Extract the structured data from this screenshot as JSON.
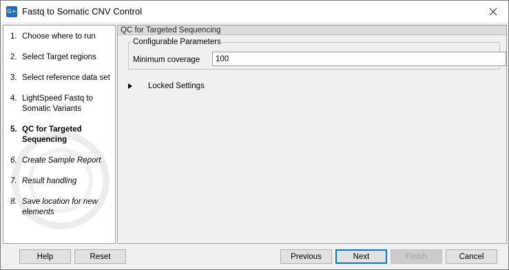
{
  "window": {
    "title": "Fastq to Somatic CNV Control",
    "app_icon_text": "G+"
  },
  "sidebar": {
    "steps": [
      {
        "num": "1.",
        "label": "Choose where to run",
        "state": "done"
      },
      {
        "num": "2.",
        "label": "Select Target regions",
        "state": "done"
      },
      {
        "num": "3.",
        "label": "Select reference data set",
        "state": "done"
      },
      {
        "num": "4.",
        "label": "LightSpeed Fastq to Somatic Variants",
        "state": "done"
      },
      {
        "num": "5.",
        "label": "QC for Targeted Sequencing",
        "state": "current"
      },
      {
        "num": "6.",
        "label": "Create Sample Report",
        "state": "future"
      },
      {
        "num": "7.",
        "label": "Result handling",
        "state": "future"
      },
      {
        "num": "8.",
        "label": "Save location for new elements",
        "state": "future"
      }
    ]
  },
  "main": {
    "section_title": "QC for Targeted Sequencing",
    "group_title": "Configurable Parameters",
    "min_coverage_label": "Minimum coverage",
    "min_coverage_value": "100",
    "locked_settings_label": "Locked Settings"
  },
  "footer": {
    "help": "Help",
    "reset": "Reset",
    "previous": "Previous",
    "next": "Next",
    "finish": "Finish",
    "cancel": "Cancel"
  },
  "colors": {
    "accent": "#0078d7",
    "app_icon": "#1f6fb8"
  },
  "icons": {
    "close": "close-icon",
    "expand": "triangle-right-icon",
    "app": "app-logo-icon"
  }
}
